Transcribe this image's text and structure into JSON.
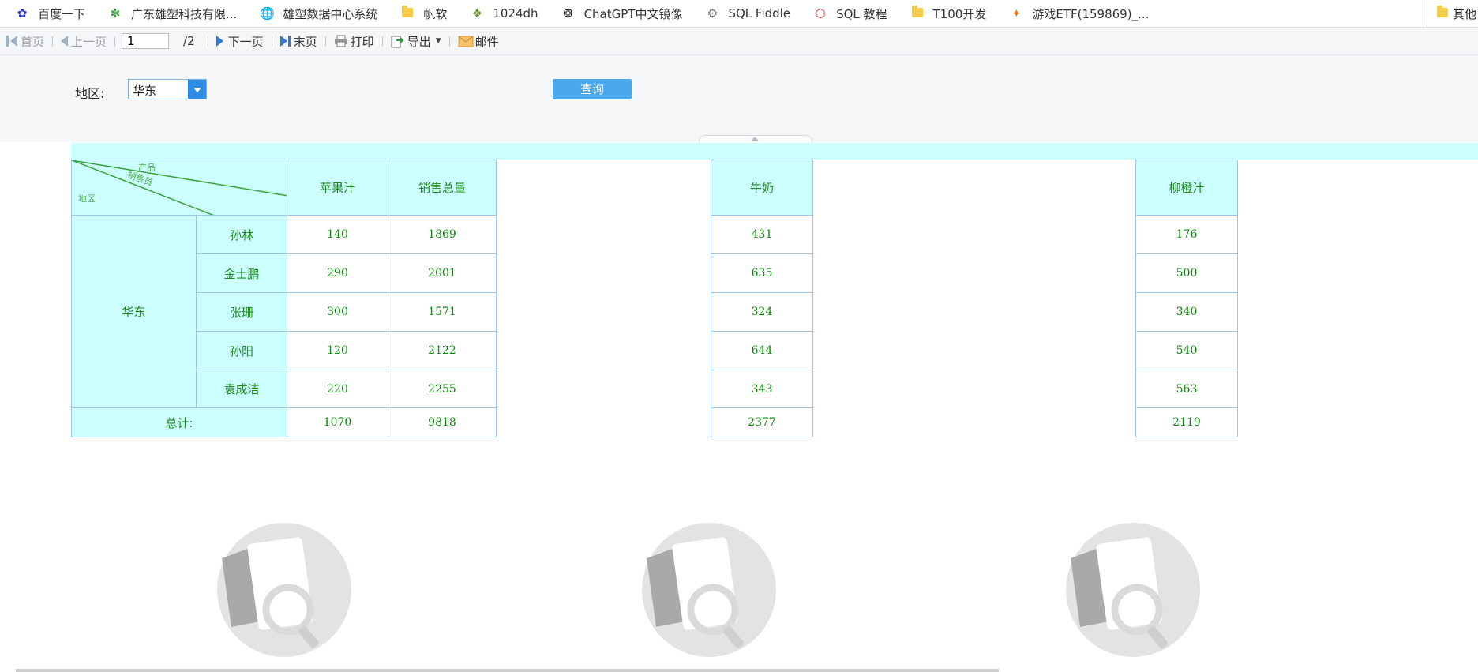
{
  "bookmarks": {
    "items": [
      {
        "label": "百度一下",
        "icon": "baidu-paw-icon",
        "color": "#2932e1"
      },
      {
        "label": "广东雄塑科技有限...",
        "icon": "gear-flower-icon",
        "color": "#27a02b"
      },
      {
        "label": "雄塑数据中心系统",
        "icon": "globe-icon",
        "color": "#444444"
      },
      {
        "label": "帆软",
        "icon": "folder-icon",
        "color": "#f5cd4a"
      },
      {
        "label": "1024dh",
        "icon": "leaf-icon",
        "color": "#6a8f2a"
      },
      {
        "label": "ChatGPT中文镜像",
        "icon": "openai-icon",
        "color": "#222222"
      },
      {
        "label": "SQL Fiddle",
        "icon": "fiddle-icon",
        "color": "#777777"
      },
      {
        "label": "SQL 教程",
        "icon": "w3-icon",
        "color": "#d33030"
      },
      {
        "label": "T100开发",
        "icon": "folder-icon",
        "color": "#f5cd4a"
      },
      {
        "label": "游戏ETF(159869)_...",
        "icon": "fire-icon",
        "color": "#f07a1a"
      }
    ],
    "other_label": "其他"
  },
  "toolbar": {
    "first": "首页",
    "prev": "上一页",
    "page_value": "1",
    "page_total": "/2",
    "next": "下一页",
    "last": "末页",
    "print": "打印",
    "export": "导出",
    "mail": "邮件"
  },
  "filter": {
    "region_label": "地区:",
    "region_value": "华东",
    "query_button": "查询"
  },
  "report": {
    "corner": {
      "product": "产品",
      "salesperson": "销售员",
      "region": "地区"
    },
    "headers": {
      "apple": "苹果汁",
      "total": "销售总量",
      "milk": "牛奶",
      "orange": "柳橙汁"
    },
    "region": "华东",
    "rows": [
      {
        "name": "孙林",
        "apple": "140",
        "total": "1869",
        "milk": "431",
        "orange": "176"
      },
      {
        "name": "金士鹏",
        "apple": "290",
        "total": "2001",
        "milk": "635",
        "orange": "500"
      },
      {
        "name": "张珊",
        "apple": "300",
        "total": "1571",
        "milk": "324",
        "orange": "340"
      },
      {
        "name": "孙阳",
        "apple": "120",
        "total": "2122",
        "milk": "644",
        "orange": "540"
      },
      {
        "name": "袁成洁",
        "apple": "220",
        "total": "2255",
        "milk": "343",
        "orange": "563"
      }
    ],
    "sum": {
      "label": "总计:",
      "apple": "1070",
      "total": "9818",
      "milk": "2377",
      "orange": "2119"
    }
  },
  "colors": {
    "header_bg": "#ccffff",
    "cell_border": "#9cc5e8",
    "data_text": "#0a8a0a",
    "query_button": "#4aa8ec",
    "select_arrow": "#2f8de4"
  }
}
